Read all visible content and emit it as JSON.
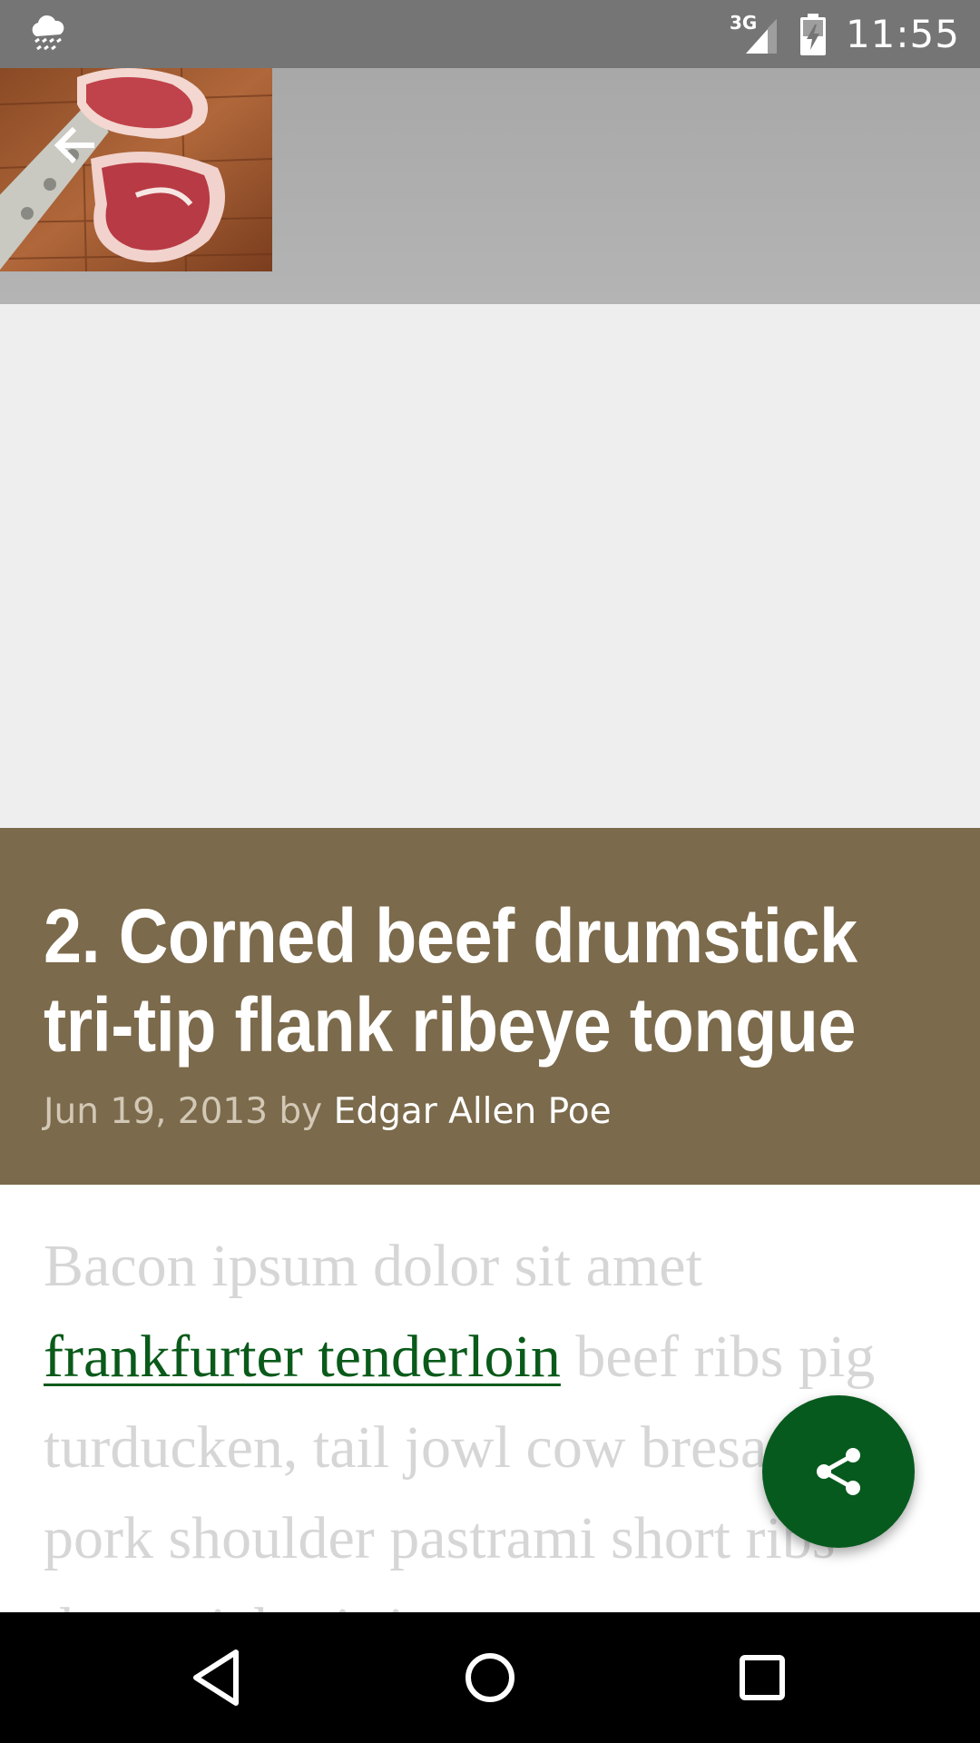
{
  "status_bar": {
    "weather_icon": "cloud-rain-icon",
    "network_label": "3G",
    "time": "11:55"
  },
  "header": {
    "back_icon": "arrow-left-icon",
    "image": "steak-cuts-photo"
  },
  "article": {
    "title": "2. Corned beef drumstick tri-tip flank ribeye tongue",
    "date": "Jun 19, 2013",
    "by": "by",
    "author": "Edgar Allen Poe",
    "body_before_link": "Bacon ipsum dolor sit amet ",
    "link_text": "frankfurter tenderloin",
    "body_after_link": " beef ribs pig turducken, tail jowl cow bresaola pork shoulder pastrami short ribs drumstick tri-tip tongue"
  },
  "fab": {
    "icon": "share-icon",
    "color": "#075a1e"
  },
  "colors": {
    "title_bg": "#7b6a4b",
    "link": "#0a5a1a"
  },
  "nav_bar": {
    "back_icon": "nav-back-icon",
    "home_icon": "nav-home-icon",
    "recents_icon": "nav-recents-icon"
  }
}
